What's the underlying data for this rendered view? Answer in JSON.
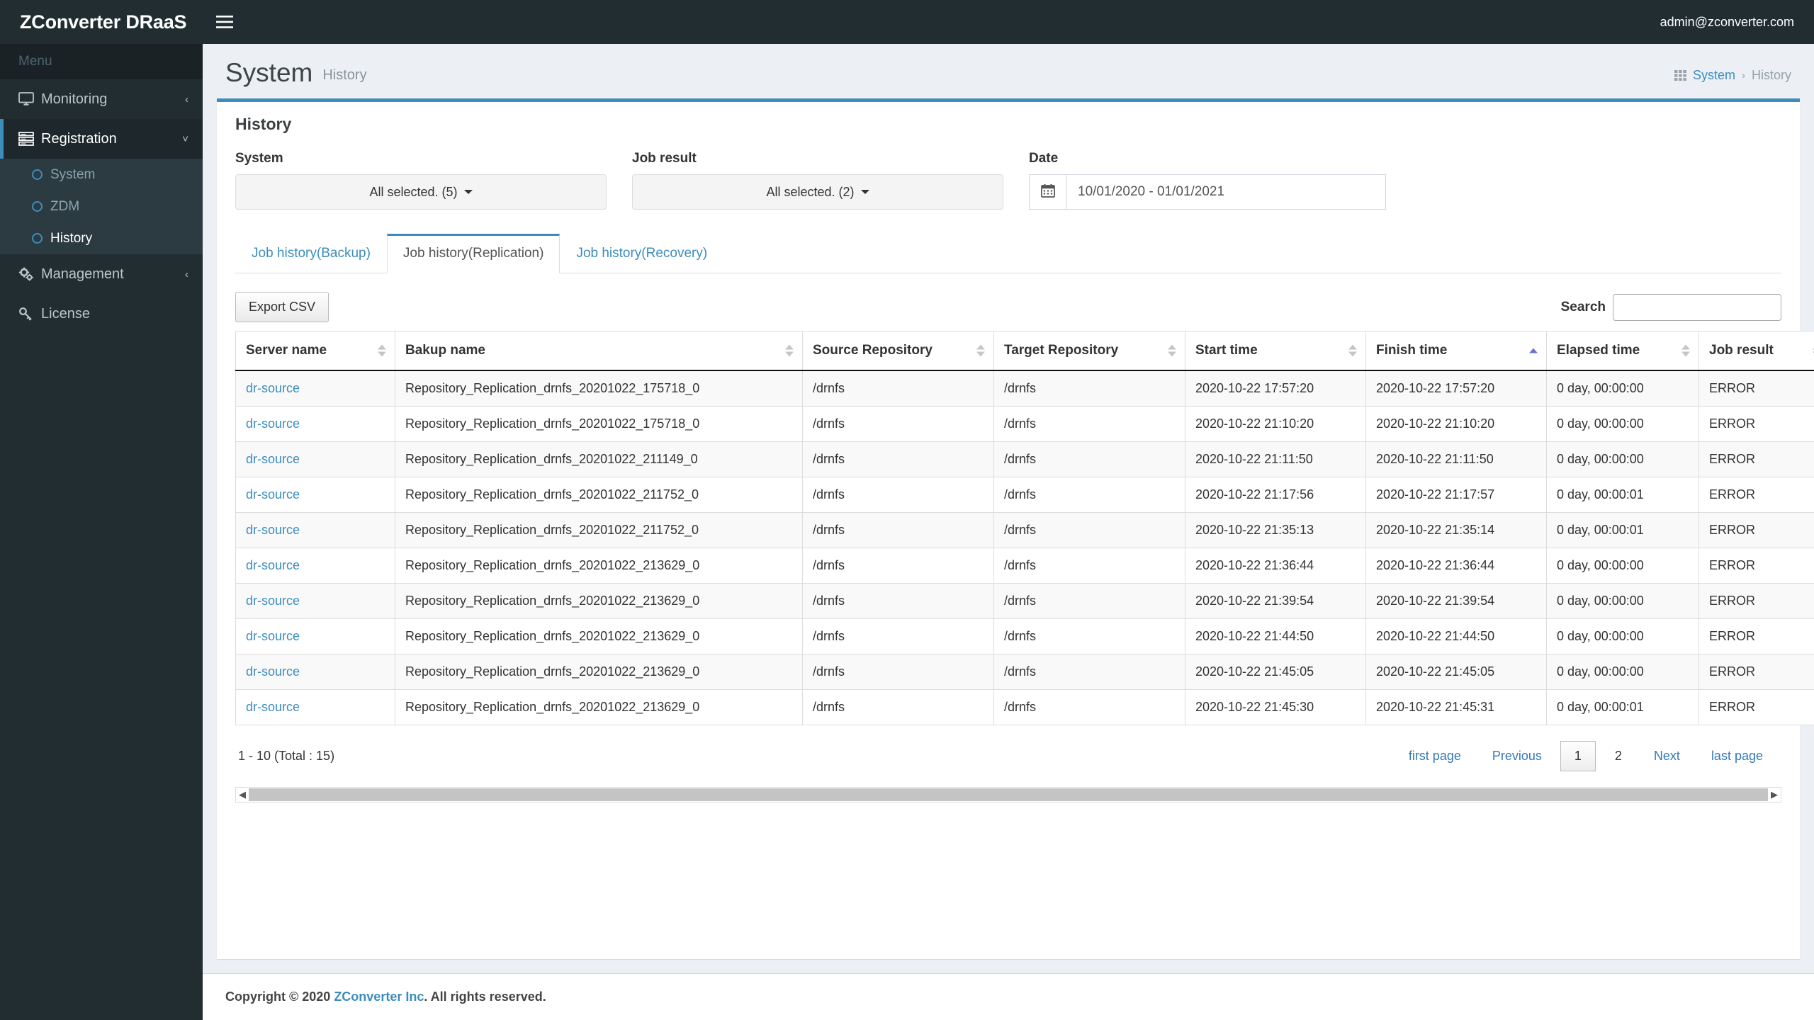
{
  "topbar": {
    "brand": "ZConverter DRaaS",
    "menu_toggle_icon": "hamburger-icon",
    "user_email": "admin@zconverter.com"
  },
  "sidebar": {
    "menu_header": "Menu",
    "items": [
      {
        "label": "Monitoring",
        "icon": "monitor-icon",
        "arrow": "‹",
        "state": "collapsed"
      },
      {
        "label": "Registration",
        "icon": "server-rack-icon",
        "arrow": "˅",
        "state": "open"
      },
      {
        "label": "Management",
        "icon": "gears-icon",
        "arrow": "‹",
        "state": "collapsed"
      },
      {
        "label": "License",
        "icon": "key-icon",
        "arrow": "",
        "state": "none"
      }
    ],
    "registration_children": [
      {
        "label": "System",
        "active": false
      },
      {
        "label": "ZDM",
        "active": false
      },
      {
        "label": "History",
        "active": true
      }
    ]
  },
  "page": {
    "title": "System",
    "subtitle": "History",
    "breadcrumb_icon": "grid-icon",
    "breadcrumb_root": "System",
    "breadcrumb_sep": "›",
    "breadcrumb_current": "History"
  },
  "box": {
    "header": "History"
  },
  "filters": {
    "system": {
      "label": "System",
      "value": "All selected. (5)"
    },
    "job_result": {
      "label": "Job result",
      "value": "All selected. (2)"
    },
    "date": {
      "label": "Date",
      "icon": "calendar-icon",
      "value": "10/01/2020 - 01/01/2021",
      "placeholder": "MM/DD/YYYY - MM/DD/YYYY"
    }
  },
  "tabs": [
    {
      "label": "Job history(Backup)",
      "active": false
    },
    {
      "label": "Job history(Replication)",
      "active": true
    },
    {
      "label": "Job history(Recovery)",
      "active": false
    }
  ],
  "tools": {
    "export_label": "Export CSV",
    "search_label": "Search",
    "search_value": "",
    "search_placeholder": ""
  },
  "table": {
    "columns": [
      {
        "label": "Server name",
        "sort": "none",
        "key": "c-server"
      },
      {
        "label": "Bakup name",
        "sort": "none",
        "key": "c-backup"
      },
      {
        "label": "Source Repository",
        "sort": "none",
        "key": "c-src"
      },
      {
        "label": "Target Repository",
        "sort": "none",
        "key": "c-tgt"
      },
      {
        "label": "Start time",
        "sort": "none",
        "key": "c-start"
      },
      {
        "label": "Finish time",
        "sort": "asc",
        "key": "c-finish"
      },
      {
        "label": "Elapsed time",
        "sort": "none",
        "key": "c-elapsed"
      },
      {
        "label": "Job result",
        "sort": "none",
        "key": "c-result"
      }
    ],
    "rows": [
      {
        "server": "dr-source",
        "backup": "Repository_Replication_drnfs_20201022_175718_0",
        "source_repo": "/drnfs",
        "target_repo": "/drnfs",
        "start": "2020-10-22 17:57:20",
        "finish": "2020-10-22 17:57:20",
        "elapsed": "0 day, 00:00:00",
        "result": "ERROR"
      },
      {
        "server": "dr-source",
        "backup": "Repository_Replication_drnfs_20201022_175718_0",
        "source_repo": "/drnfs",
        "target_repo": "/drnfs",
        "start": "2020-10-22 21:10:20",
        "finish": "2020-10-22 21:10:20",
        "elapsed": "0 day, 00:00:00",
        "result": "ERROR"
      },
      {
        "server": "dr-source",
        "backup": "Repository_Replication_drnfs_20201022_211149_0",
        "source_repo": "/drnfs",
        "target_repo": "/drnfs",
        "start": "2020-10-22 21:11:50",
        "finish": "2020-10-22 21:11:50",
        "elapsed": "0 day, 00:00:00",
        "result": "ERROR"
      },
      {
        "server": "dr-source",
        "backup": "Repository_Replication_drnfs_20201022_211752_0",
        "source_repo": "/drnfs",
        "target_repo": "/drnfs",
        "start": "2020-10-22 21:17:56",
        "finish": "2020-10-22 21:17:57",
        "elapsed": "0 day, 00:00:01",
        "result": "ERROR"
      },
      {
        "server": "dr-source",
        "backup": "Repository_Replication_drnfs_20201022_211752_0",
        "source_repo": "/drnfs",
        "target_repo": "/drnfs",
        "start": "2020-10-22 21:35:13",
        "finish": "2020-10-22 21:35:14",
        "elapsed": "0 day, 00:00:01",
        "result": "ERROR"
      },
      {
        "server": "dr-source",
        "backup": "Repository_Replication_drnfs_20201022_213629_0",
        "source_repo": "/drnfs",
        "target_repo": "/drnfs",
        "start": "2020-10-22 21:36:44",
        "finish": "2020-10-22 21:36:44",
        "elapsed": "0 day, 00:00:00",
        "result": "ERROR"
      },
      {
        "server": "dr-source",
        "backup": "Repository_Replication_drnfs_20201022_213629_0",
        "source_repo": "/drnfs",
        "target_repo": "/drnfs",
        "start": "2020-10-22 21:39:54",
        "finish": "2020-10-22 21:39:54",
        "elapsed": "0 day, 00:00:00",
        "result": "ERROR"
      },
      {
        "server": "dr-source",
        "backup": "Repository_Replication_drnfs_20201022_213629_0",
        "source_repo": "/drnfs",
        "target_repo": "/drnfs",
        "start": "2020-10-22 21:44:50",
        "finish": "2020-10-22 21:44:50",
        "elapsed": "0 day, 00:00:00",
        "result": "ERROR"
      },
      {
        "server": "dr-source",
        "backup": "Repository_Replication_drnfs_20201022_213629_0",
        "source_repo": "/drnfs",
        "target_repo": "/drnfs",
        "start": "2020-10-22 21:45:05",
        "finish": "2020-10-22 21:45:05",
        "elapsed": "0 day, 00:00:00",
        "result": "ERROR"
      },
      {
        "server": "dr-source",
        "backup": "Repository_Replication_drnfs_20201022_213629_0",
        "source_repo": "/drnfs",
        "target_repo": "/drnfs",
        "start": "2020-10-22 21:45:30",
        "finish": "2020-10-22 21:45:31",
        "elapsed": "0 day, 00:00:01",
        "result": "ERROR"
      }
    ]
  },
  "pagination": {
    "info": "1 - 10 (Total : 15)",
    "first": "first page",
    "previous": "Previous",
    "pages": [
      {
        "label": "1",
        "current": true
      },
      {
        "label": "2",
        "current": false
      }
    ],
    "next": "Next",
    "last": "last page"
  },
  "footer": {
    "copyright_prefix": "Copyright © 2020 ",
    "company": "ZConverter Inc",
    "copyright_suffix": ". All rights reserved."
  },
  "colors": {
    "accent": "#3c8dbc",
    "sidebar_bg": "#222d32",
    "sidebar_sub_bg": "#2c3b41",
    "content_bg": "#ecf0f5",
    "link": "#337ab7"
  }
}
